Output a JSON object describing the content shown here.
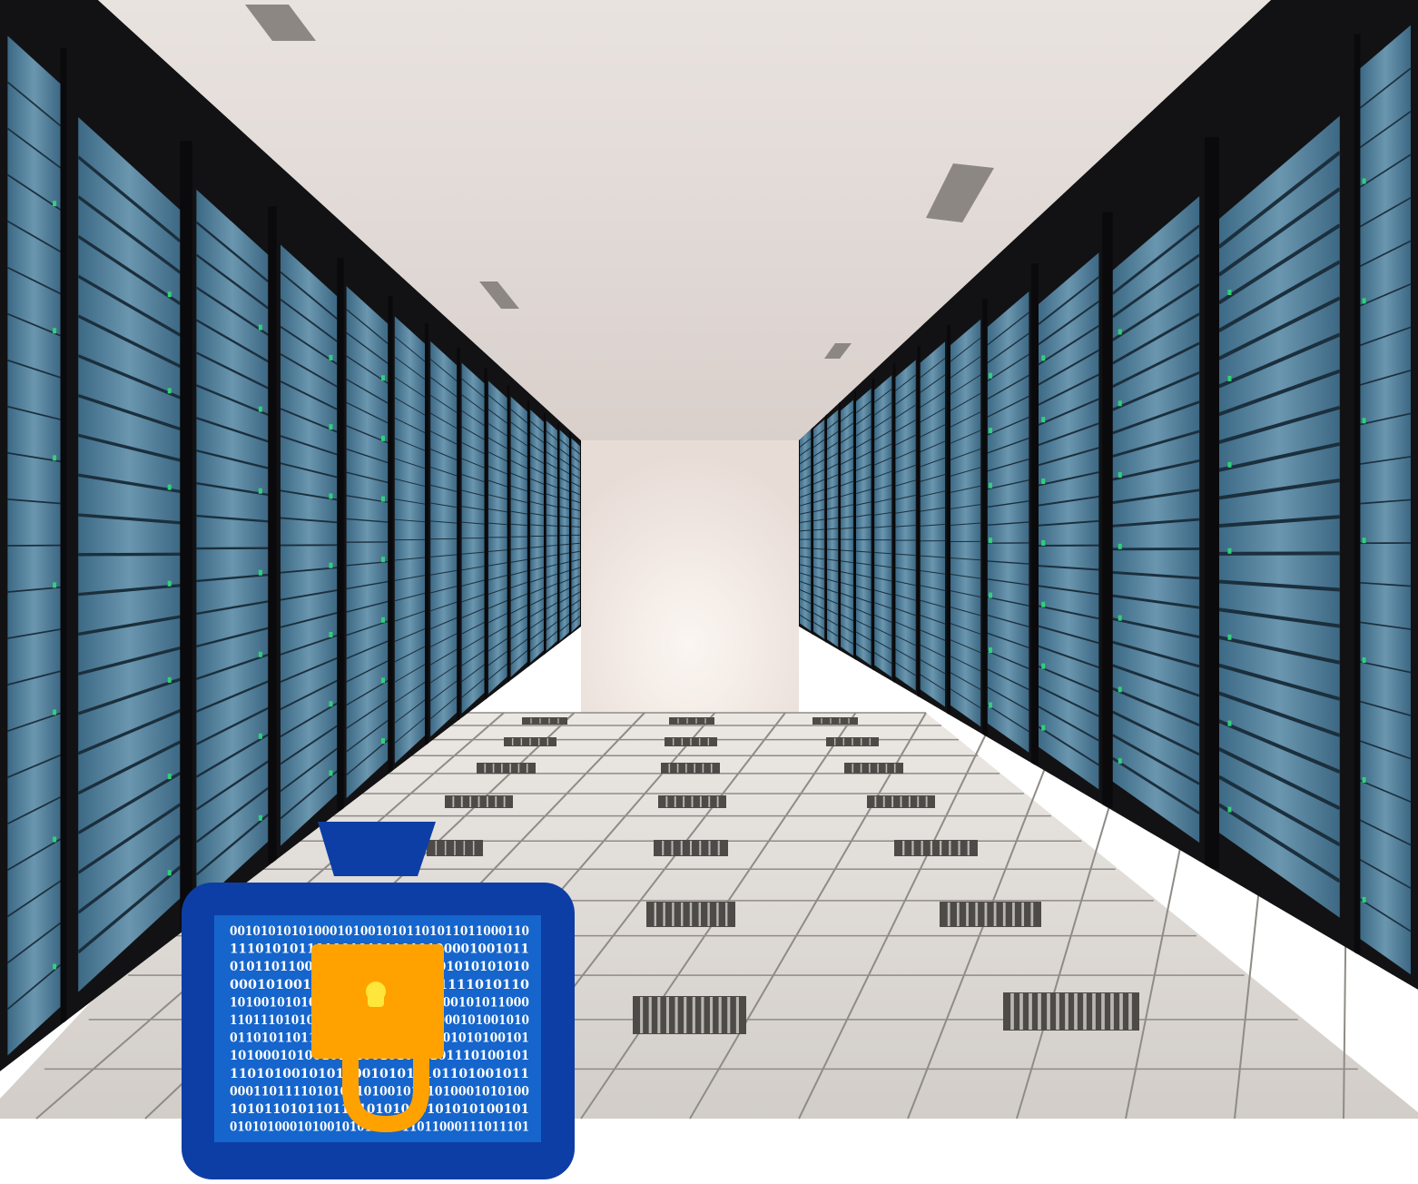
{
  "scene": {
    "subject": "server room corridor",
    "colors": {
      "ceiling": "#e4ddd8",
      "back_wall": "#f4ebe6",
      "floor": "#ddd8d3",
      "floor_grout": "#8f8b86",
      "floor_vent": "#4d4a47",
      "rack_frame": "#141416",
      "rack_panel": "#4d7e99",
      "rack_light": "#2fd17a"
    }
  },
  "security_badge": {
    "icon": "padlock-on-binary-screen-icon",
    "colors": {
      "frame": "#0d3ea5",
      "screen": "#1565cc",
      "padlock": "#ffa200",
      "keyhole": "#ffe63a",
      "digits": "#ffffff"
    },
    "binary_lines": [
      "001010101010001010010101101011011000110",
      "11101010110100101011010100001001011",
      "010110110001010100101001001010101010",
      "000101001010101101010101111010110",
      "10100101010110101011011000100101011000",
      "110111010101010100100100101000101001010",
      "01101011011000101010101101001010100101",
      "101000101001010100101010101110100101",
      "1101010010101000101010101101001011",
      "00011011110101001010010101010001010100",
      "10101101011011010101010101010100101",
      "0101010001010010101101011011000111011101"
    ]
  }
}
